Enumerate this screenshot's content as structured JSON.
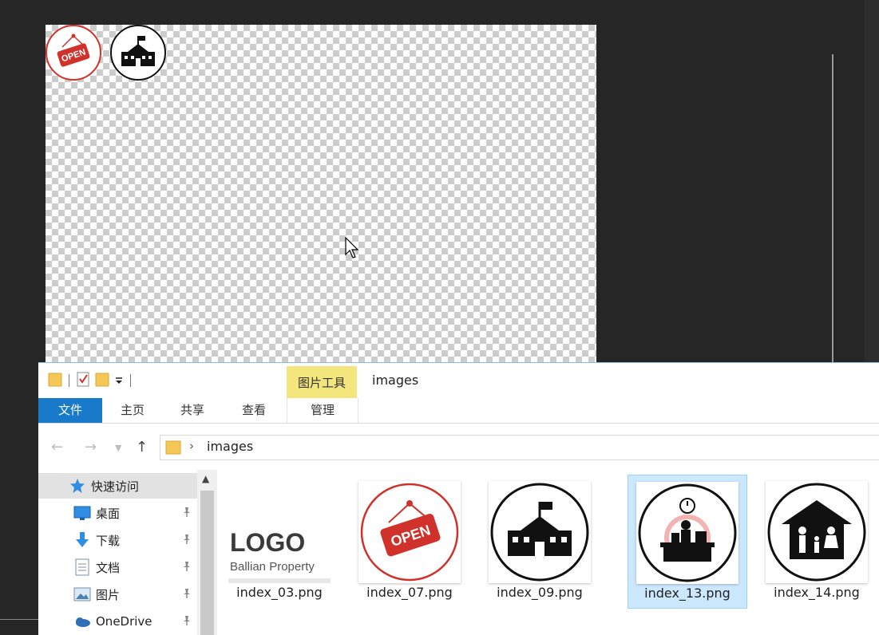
{
  "canvas": {
    "icons": [
      {
        "name": "open-sign-icon",
        "text": "OPEN"
      },
      {
        "name": "school-icon"
      }
    ]
  },
  "explorer": {
    "title": "images",
    "context_tab_header": "图片工具",
    "ribbon_tabs": {
      "file": "文件",
      "home": "主页",
      "share": "共享",
      "view": "查看",
      "manage": "管理"
    },
    "address": {
      "path": "images"
    },
    "nav": {
      "items": [
        {
          "label": "快速访问",
          "icon": "star-icon",
          "selected": true
        },
        {
          "label": "桌面",
          "icon": "desktop-icon",
          "pinned": true
        },
        {
          "label": "下载",
          "icon": "download-arrow-icon",
          "pinned": true
        },
        {
          "label": "文档",
          "icon": "document-icon",
          "pinned": true
        },
        {
          "label": "图片",
          "icon": "pictures-icon",
          "pinned": true
        },
        {
          "label": "OneDrive",
          "icon": "cloud-icon",
          "pinned": true
        }
      ]
    },
    "files": [
      {
        "name": "index_03.png",
        "thumb_text": [
          "LOGO",
          "Ballian Property"
        ]
      },
      {
        "name": "index_07.png",
        "thumb_text": [
          "OPEN"
        ]
      },
      {
        "name": "index_09.png"
      },
      {
        "name": "index_13.png",
        "selected": true
      },
      {
        "name": "index_14.png"
      }
    ]
  },
  "colors": {
    "ribbon_file_tab": "#1979ca",
    "context_tab": "#f2e67d",
    "selection": "#cce8ff",
    "open_red": "#d0322b"
  }
}
